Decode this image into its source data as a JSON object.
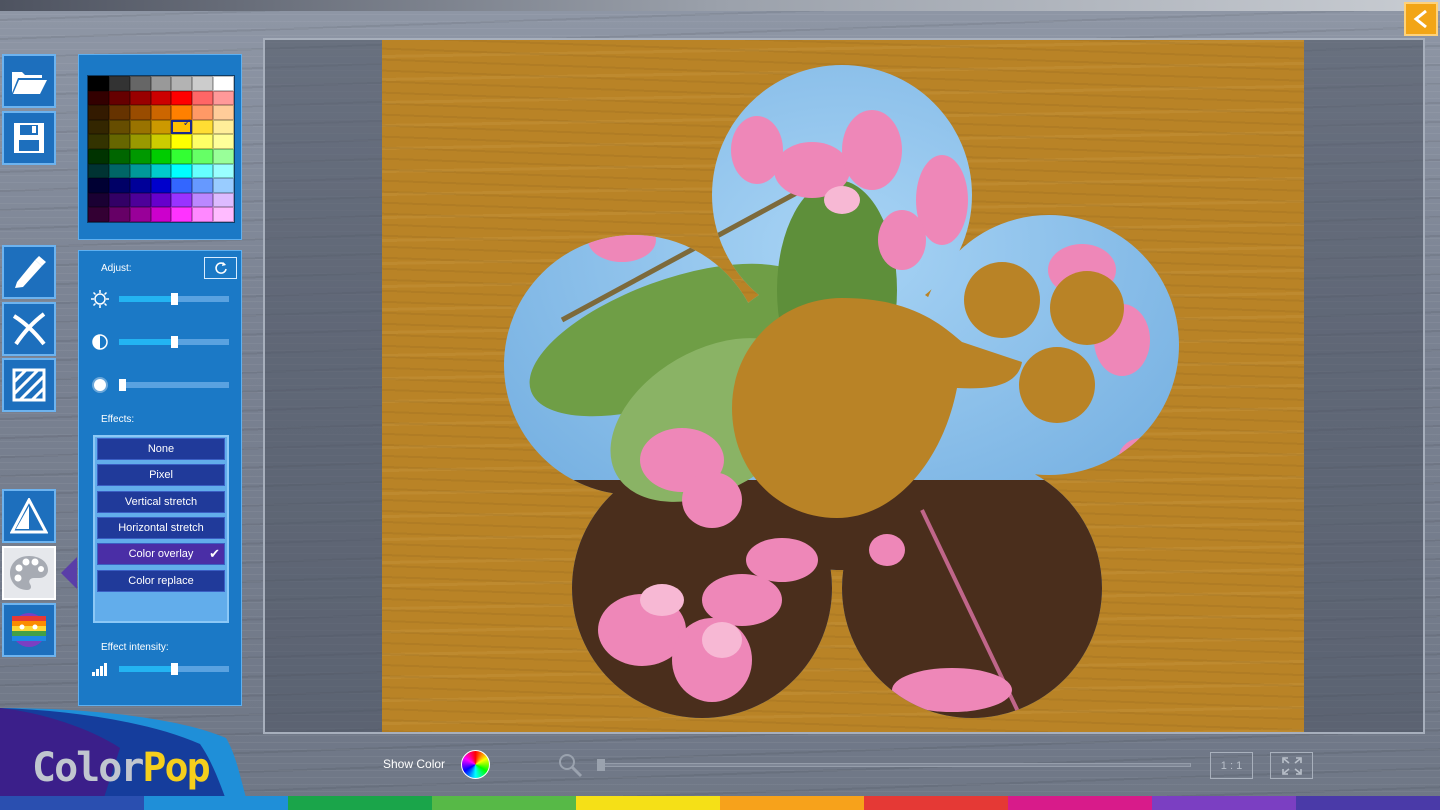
{
  "app": {
    "name_part1": "Color",
    "name_part2": "Pop"
  },
  "toolbar": {
    "open_icon": "folder-open-icon",
    "save_icon": "floppy-save-icon",
    "pencil_icon": "pencil-icon",
    "eraser_icon": "cross-cut-icon",
    "pattern_icon": "hatch-pattern-icon",
    "shape_icon": "triangle-shape-icon",
    "palette_icon": "paint-palette-icon",
    "effects_icon": "rainbow-effects-icon",
    "back_icon": "chevron-left-icon"
  },
  "palette": {
    "colors": [
      "#000000",
      "#333333",
      "#666666",
      "#999999",
      "#b3b3b3",
      "#cccccc",
      "#ffffff",
      "#330000",
      "#660000",
      "#990000",
      "#cc0000",
      "#ff0000",
      "#ff6666",
      "#ff9999",
      "#331a00",
      "#663300",
      "#994c00",
      "#cc6600",
      "#ff8000",
      "#ff9966",
      "#ffcc99",
      "#332600",
      "#664d00",
      "#997300",
      "#cc9900",
      "#ffbf00",
      "#ffdd33",
      "#ffee99",
      "#333300",
      "#666600",
      "#999900",
      "#cccc00",
      "#ffff00",
      "#ffff66",
      "#ffff99",
      "#003300",
      "#006600",
      "#009900",
      "#00cc00",
      "#33ff33",
      "#66ff66",
      "#99ff99",
      "#003333",
      "#006666",
      "#009999",
      "#00cccc",
      "#00ffff",
      "#66ffff",
      "#99ffff",
      "#000033",
      "#000066",
      "#000099",
      "#0000cc",
      "#3366ff",
      "#6699ff",
      "#99ccff",
      "#1a0033",
      "#330066",
      "#4d0099",
      "#6600cc",
      "#9933ff",
      "#bb88ff",
      "#ddbbff",
      "#330033",
      "#660066",
      "#990099",
      "#cc00cc",
      "#ff33ff",
      "#ff88ff",
      "#ffbbff"
    ],
    "selected_index": 25
  },
  "adjust": {
    "title": "Adjust:",
    "reset_icon": "refresh-icon",
    "brightness_icon": "sun-icon",
    "contrast_icon": "contrast-icon",
    "blur_icon": "blur-icon",
    "brightness": 0.5,
    "contrast": 0.5,
    "blur": 0.03
  },
  "effects": {
    "title": "Effects:",
    "items": [
      "None",
      "Pixel",
      "Vertical stretch",
      "Horizontal stretch",
      "Color overlay",
      "Color replace"
    ],
    "selected": "Color overlay"
  },
  "intensity": {
    "title": "Effect intensity:",
    "icon": "signal-bars-icon",
    "value": 0.5
  },
  "bottom": {
    "show_color_label": "Show Color",
    "zoom_icon": "magnifier-icon",
    "zoom": 0.0,
    "one_to_one_label": "1 : 1",
    "fit_icon": "fit-screen-icon"
  },
  "colors": {
    "panel_blue": "#1b79c6",
    "effect_blue": "#203a9a",
    "selected_purple": "#4a2ea6",
    "wood": "#b98326",
    "accent_orange": "#f2a516"
  }
}
